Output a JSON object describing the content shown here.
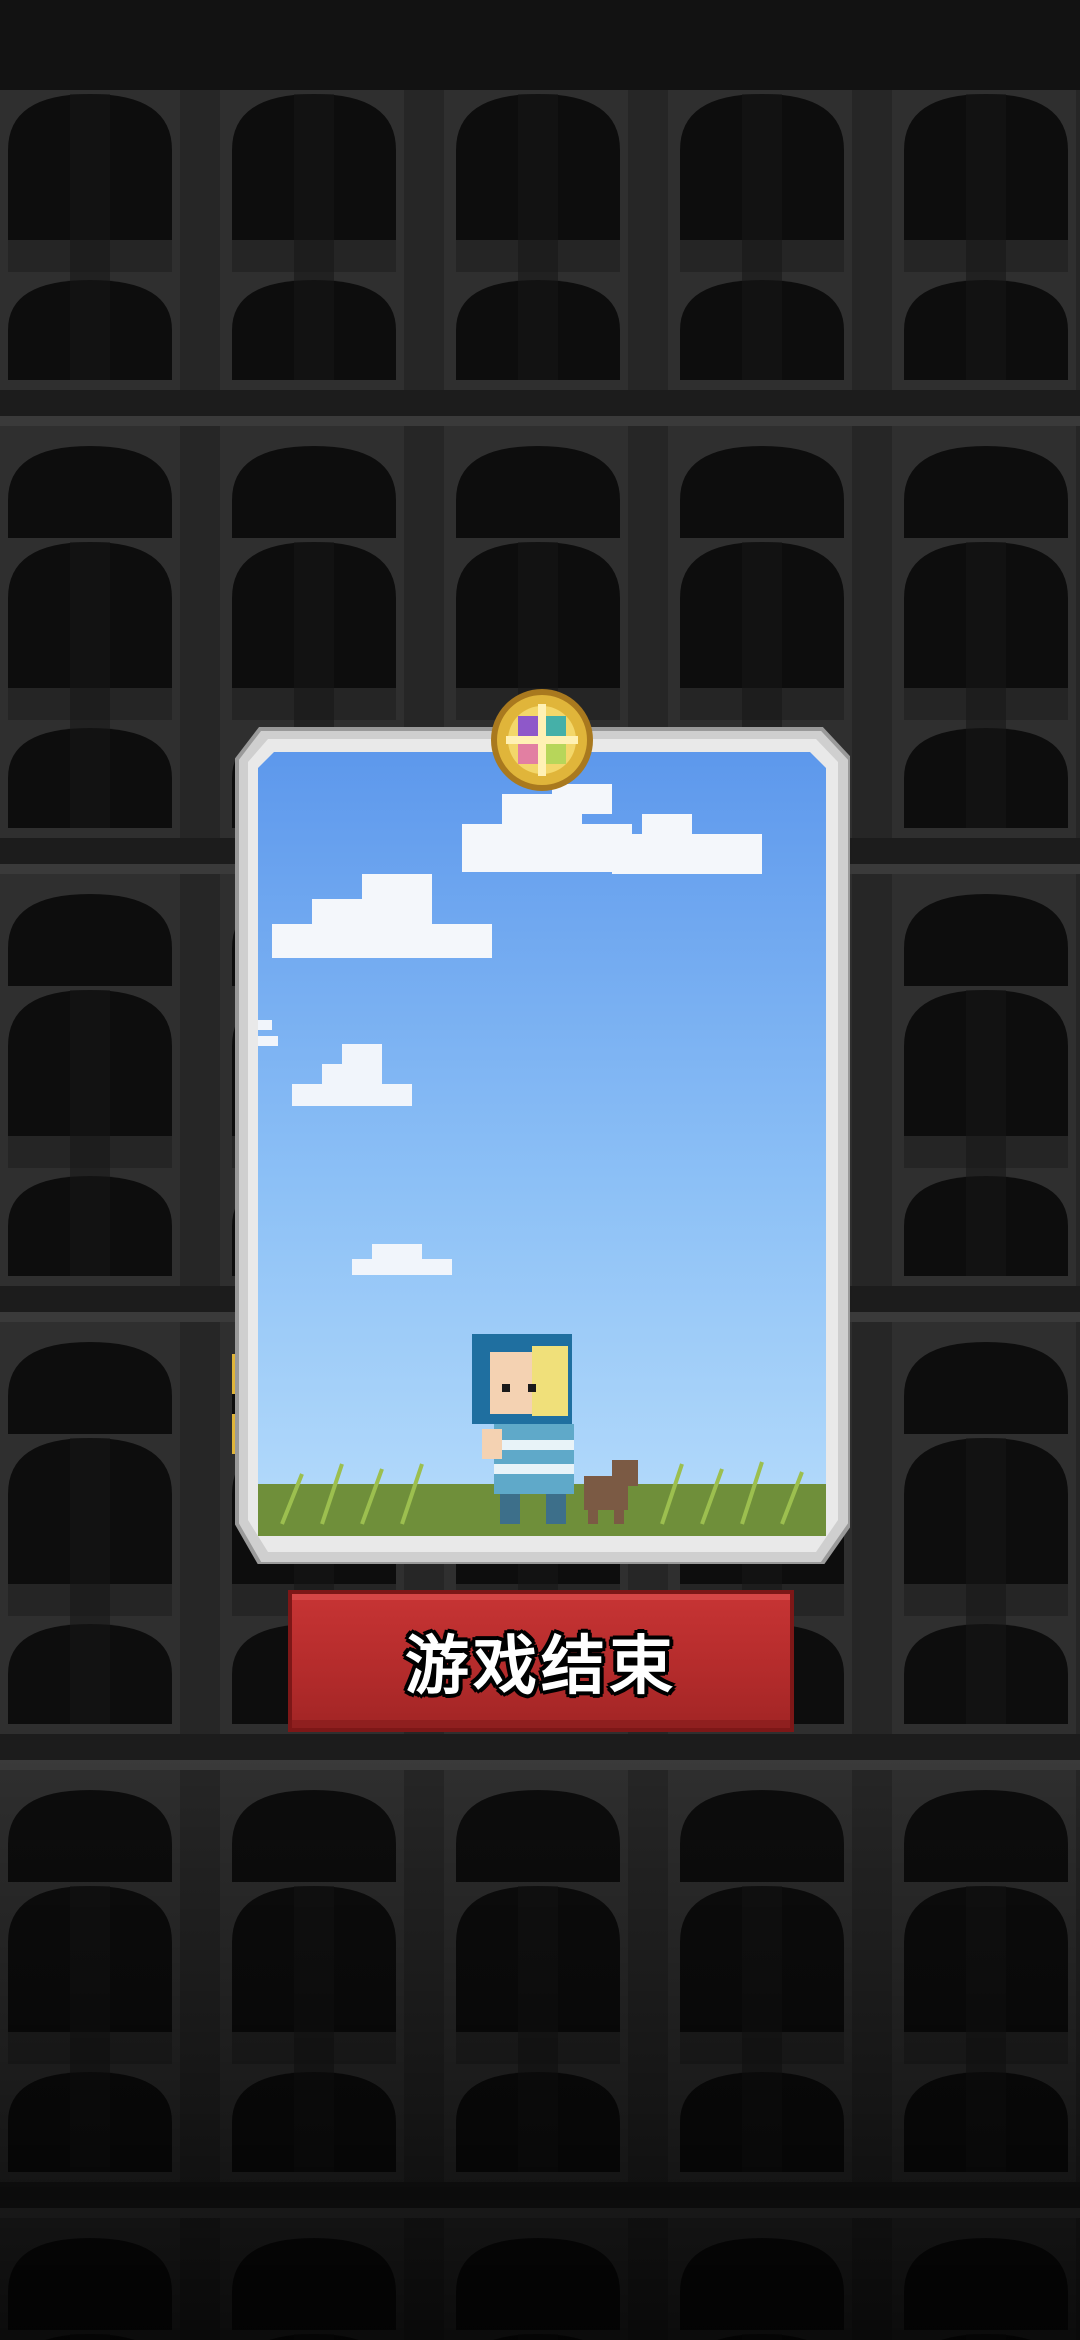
{
  "game": {
    "over_button_label": "游戏结束"
  },
  "colors": {
    "button": "#b32b2b",
    "sky_top": "#5d98ec",
    "sky_bottom": "#b6dcfb",
    "frame": "#d8d8d8",
    "grass": "#6f8f3a",
    "emblem_gold": "#e0b53a"
  },
  "icons": {
    "emblem": "compass-emblem-icon"
  }
}
